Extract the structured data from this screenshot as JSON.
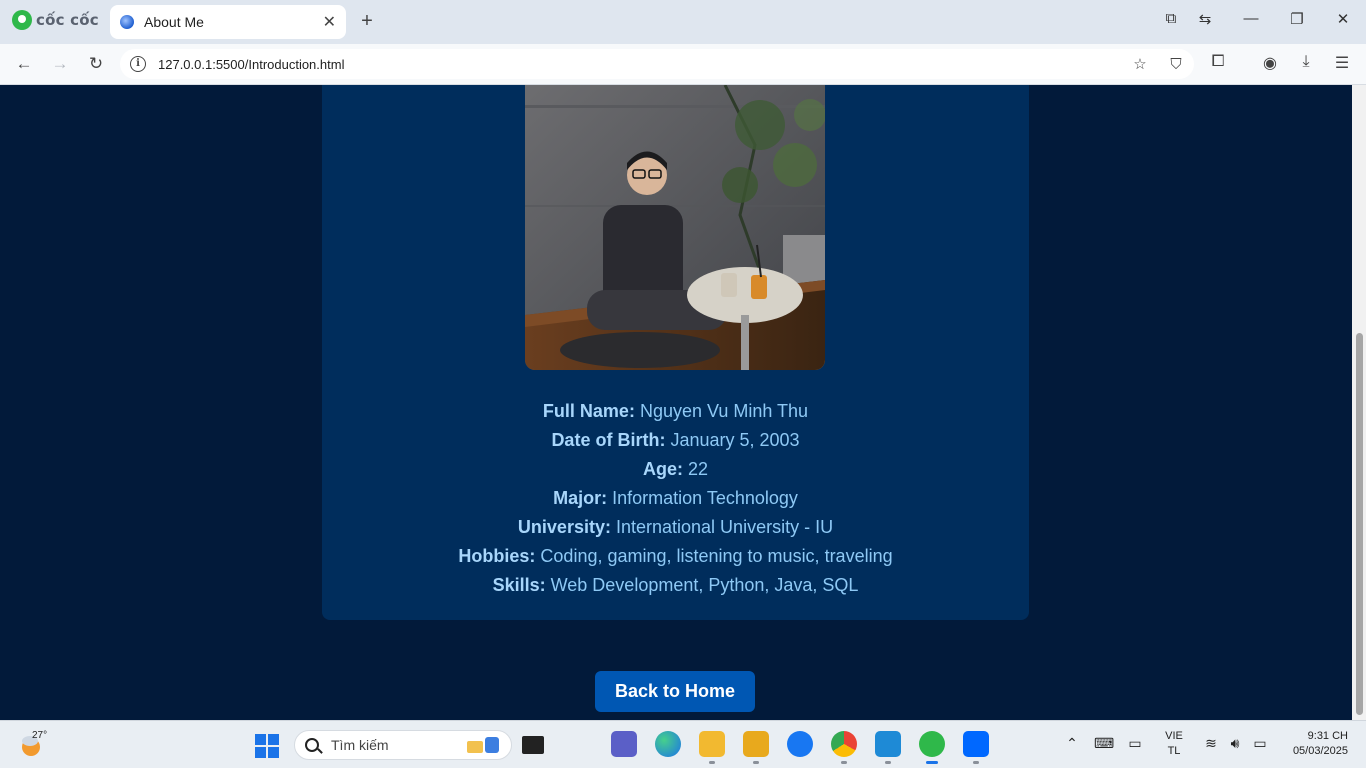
{
  "browser": {
    "brand": "cốc cốc",
    "tab_title": "About Me",
    "url": "127.0.0.1:5500/Introduction.html"
  },
  "profile": {
    "fields": [
      {
        "label": "Full Name:",
        "value": "Nguyen Vu Minh Thu"
      },
      {
        "label": "Date of Birth:",
        "value": "January 5, 2003"
      },
      {
        "label": "Age:",
        "value": "22"
      },
      {
        "label": "Major:",
        "value": "Information Technology"
      },
      {
        "label": "University:",
        "value": "International University - IU"
      },
      {
        "label": "Hobbies:",
        "value": "Coding, gaming, listening to music, traveling"
      },
      {
        "label": "Skills:",
        "value": "Web Development, Python, Java, SQL"
      }
    ],
    "back_button": "Back to Home"
  },
  "taskbar": {
    "weather_temp": "27°",
    "search_placeholder": "Tìm kiếm",
    "language_top": "VIE",
    "language_bottom": "TL",
    "time": "9:31 CH",
    "date": "05/03/2025"
  },
  "colors": {
    "page_bg": "#021a3a",
    "card_bg": "#002d5c",
    "text": "#8ec9f5",
    "button_bg": "#0057b3"
  }
}
